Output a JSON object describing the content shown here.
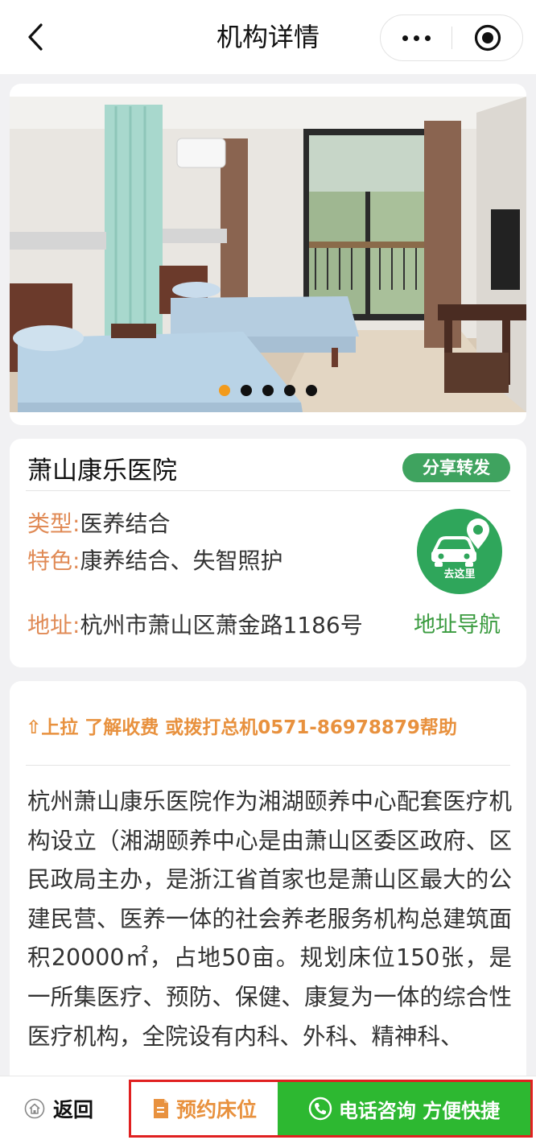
{
  "nav": {
    "title": "机构详情",
    "back_icon": "chevron-left-icon",
    "more_icon": "more-dots-icon",
    "close_icon": "target-icon"
  },
  "carousel": {
    "image_alt": "room-photo",
    "slide_count": 5,
    "active_index": 0,
    "active_dot_color": "#f39b1c"
  },
  "institution": {
    "name": "萧山康乐医院",
    "share_label": "分享转发",
    "type_label": "类型:",
    "type_value": "医养结合",
    "feature_label": "特色:",
    "feature_value": "康养结合、失智照护",
    "address_label": "地址:",
    "address_value": "杭州市萧山区萧金路1186号",
    "go_here_label": "去这里",
    "nav_link_label": "地址导航",
    "label_color": "#e08a55",
    "accent_green": "#3fa35f"
  },
  "description": {
    "notice": "⇧上拉 了解收费 或拨打总机0571-86978879帮助",
    "text": "杭州萧山康乐医院作为湘湖颐养中心配套医疗机构设立（湘湖颐养中心是由萧山区委区政府、区民政局主办，是浙江省首家也是萧山区最大的公建民营、医养一体的社会养老服务机构总建筑面积20000㎡，占地50亩。规划床位150张，是一所集医疗、预防、保健、康复为一体的综合性医疗机构，全院设有内科、外科、精神科、"
  },
  "bottom_bar": {
    "back_label": "返回",
    "book_label": "预约床位",
    "call_label": "电话咨询 方便快捷",
    "call_color": "#2db831",
    "book_color": "#e8913e",
    "highlight_color": "#e02020"
  }
}
